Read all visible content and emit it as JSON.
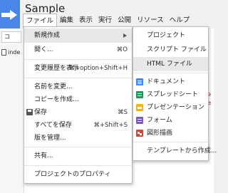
{
  "app": {
    "title": "Sample"
  },
  "menubar": [
    "ファイル",
    "編集",
    "表示",
    "実行",
    "公開",
    "リソース",
    "ヘルプ"
  ],
  "left_panel": {
    "button_label": "コ",
    "file_name": "inde"
  },
  "editor": {
    "snippet_1": "e",
    "snippet_2": "e",
    "snippet_3": "c"
  },
  "file_menu": {
    "new": "新規作成",
    "open": "開く...",
    "open_shortcut": "⌘O",
    "history": "変更履歴を表示",
    "history_shortcut": "⌘+option+Shift+H",
    "rename": "名前を変更...",
    "make_copy": "コピーを作成...",
    "save": "保存",
    "save_shortcut": "⌘S",
    "save_all": "すべてを保存",
    "save_all_shortcut": "⌘+Shift+S",
    "manage_versions": "版を管理...",
    "share": "共有...",
    "project_properties": "プロジェクトのプロパティ"
  },
  "new_submenu": {
    "project": "プロジェクト",
    "script_file": "スクリプト ファイル",
    "html_file": "HTML ファイル",
    "document": "ドキュメント",
    "spreadsheet": "スプレッドシート",
    "presentation": "プレゼンテーション",
    "form": "フォーム",
    "drawing": "図形描画",
    "from_template": "テンプレートから作成..."
  },
  "colors": {
    "brand_blue": "#4a86e8",
    "doc_blue": "#4285f4",
    "sheet_green": "#0f9d58",
    "slides_yellow": "#f4b400",
    "form_purple": "#7e57c2",
    "drawing_red": "#db4437"
  }
}
